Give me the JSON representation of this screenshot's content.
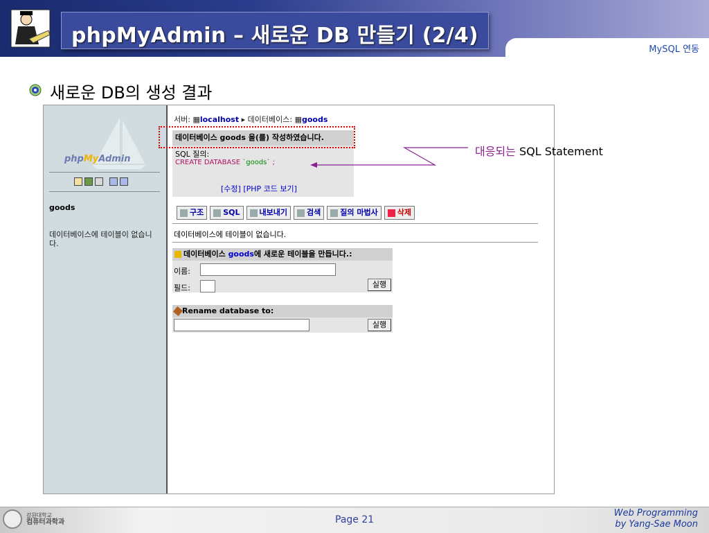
{
  "header": {
    "title": "phpMyAdmin – 새로운 DB 만들기 (2/4)",
    "section_link": "MySQL 연동"
  },
  "slide": {
    "subtitle": "새로운 DB의 생성 결과",
    "annotation_prefix": "대응되는 ",
    "annotation_rest": "SQL Statement"
  },
  "pma": {
    "logo_php": "php",
    "logo_my": "My",
    "logo_admin": "Admin",
    "left_db": "goods",
    "left_msg": "데이터베이스에 테이블이 없습니다.",
    "breadcrumb_server": "서버:",
    "breadcrumb_host": "localhost",
    "breadcrumb_db_label": "데이터베이스:",
    "breadcrumb_db": "goods",
    "success_msg": "데이터베이스 goods 을(를) 작성하였습니다.",
    "sql_label": "SQL 질의:",
    "sql_kw": "CREATE DATABASE",
    "sql_name": "`goods`",
    "sql_end": ";",
    "links": "[수정] [PHP 코드 보기]",
    "tabs": [
      {
        "label": "구조"
      },
      {
        "label": "SQL"
      },
      {
        "label": "내보내기"
      },
      {
        "label": "검색"
      },
      {
        "label": "질의 마법사"
      },
      {
        "label": "삭제"
      }
    ],
    "no_tables": "데이터베이스에 테이블이 없습니다.",
    "new_table_prefix": "데이터베이스 ",
    "new_table_db": "goods",
    "new_table_suffix": "에 새로운 테이블을 만듭니다.:",
    "name_label": "이름:",
    "fields_label": "필드:",
    "go_label": "실행",
    "rename_label": "Rename database to:"
  },
  "footer": {
    "univ_line1": "강원대학교",
    "univ_line2": "컴퓨터과학과",
    "page": "Page 21",
    "credit1": "Web Programming",
    "credit2": "by Yang-Sae Moon"
  },
  "colors": {
    "header_dark": "#1a2a6e",
    "title_box": "#3a4b9e",
    "pma_left": "#d0dce0",
    "dotted_border": "#e00000",
    "annotation_line": "#8a2090"
  }
}
